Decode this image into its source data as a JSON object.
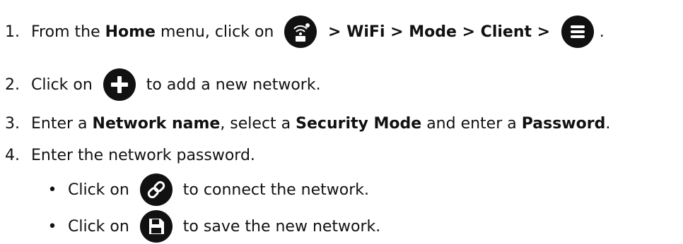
{
  "steps": [
    {
      "number": "1.",
      "t1": "From the ",
      "b1": "Home",
      "t2": " menu, click on ",
      "t3": " > WiFi > Mode > Client > ",
      "t4": "."
    },
    {
      "number": "2.",
      "t1": "Click on ",
      "t2": " to add a new network."
    },
    {
      "number": "3.",
      "t1": "Enter a ",
      "b1": "Network name",
      "t2": ", select a ",
      "b2": "Security Mode",
      "t3": " and enter a ",
      "b3": "Password",
      "t4": "."
    },
    {
      "number": "4.",
      "t1": "Enter the network password."
    }
  ],
  "bullets": [
    {
      "marker": "•",
      "t1": "Click on ",
      "t2": " to connect the network."
    },
    {
      "marker": "•",
      "t1": "Click on ",
      "t2": " to save the new network."
    }
  ],
  "icons": {
    "router": "router-settings-icon",
    "list": "list-menu-icon",
    "add": "add-plus-icon",
    "link": "link-chain-icon",
    "save": "save-floppy-icon"
  },
  "colors": {
    "text": "#111111",
    "icon_bg": "#111111",
    "icon_fg": "#ffffff"
  }
}
